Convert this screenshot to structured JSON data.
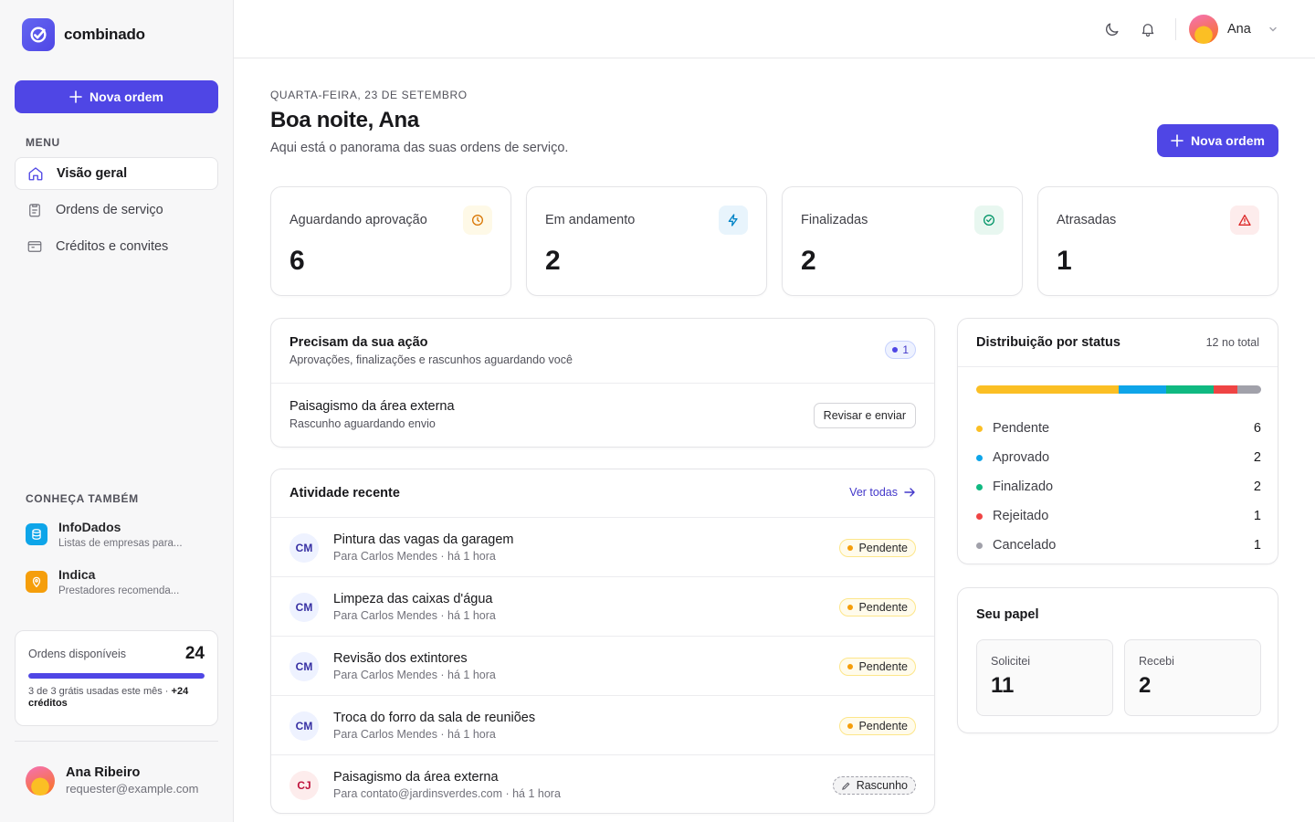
{
  "app": {
    "name": "combinado"
  },
  "sidebar": {
    "new_button": "Nova ordem",
    "menu_label": "MENU",
    "items": [
      {
        "label": "Visão geral",
        "icon": "home-icon",
        "active": true
      },
      {
        "label": "Ordens de serviço",
        "icon": "clipboard-icon",
        "active": false
      },
      {
        "label": "Créditos e convites",
        "icon": "wallet-icon",
        "active": false
      }
    ],
    "discover_label": "CONHEÇA TAMBÉM",
    "promos": [
      {
        "title": "InfoDados",
        "desc": "Listas de empresas para...",
        "color": "#0ea5e9"
      },
      {
        "title": "Indica",
        "desc": "Prestadores recomenda...",
        "color": "#f59e0b"
      }
    ],
    "credits": {
      "label": "Ordens disponíveis",
      "count": "24",
      "progress": 1.0,
      "note": "3 de 3 grátis usadas este mês · ",
      "note_bold": "+24 créditos"
    },
    "user": {
      "name": "Ana Ribeiro",
      "email": "requester@example.com"
    }
  },
  "topbar": {
    "user_name": "Ana",
    "icons": [
      "moon-icon",
      "bell-icon",
      "chevron-down-icon"
    ]
  },
  "header": {
    "date": "QUARTA-FEIRA, 23 DE SETEMBRO",
    "greeting": "Boa noite, Ana",
    "subtitle": "Aqui está o panorama das suas ordens de serviço.",
    "new_button": "Nova ordem"
  },
  "stats": [
    {
      "title": "Aguardando aprovação",
      "value": "6",
      "icon": "clock-icon",
      "color": "#d97706",
      "bg": "#fef9e7"
    },
    {
      "title": "Em andamento",
      "value": "2",
      "icon": "bolt-icon",
      "color": "#0284c7",
      "bg": "#e8f4fc"
    },
    {
      "title": "Finalizadas",
      "value": "2",
      "icon": "check-circle-icon",
      "color": "#059669",
      "bg": "#e8f7f0"
    },
    {
      "title": "Atrasadas",
      "value": "1",
      "icon": "alert-triangle-icon",
      "color": "#dc2626",
      "bg": "#fdecec"
    }
  ],
  "action": {
    "title": "Precisam da sua ação",
    "subtitle": "Aprovações, finalizações e rascunhos aguardando você",
    "count": "1",
    "item": {
      "title": "Paisagismo da área externa",
      "subtitle": "Rascunho aguardando envio",
      "button": "Revisar e enviar"
    }
  },
  "activity": {
    "title": "Atividade recente",
    "view_all": "Ver todas",
    "rows": [
      {
        "initials": "CM",
        "title": "Pintura das vagas da garagem",
        "meta": "Para Carlos Mendes · há 1 hora",
        "status": "Pendente",
        "kind": "pending"
      },
      {
        "initials": "CM",
        "title": "Limpeza das caixas d'água",
        "meta": "Para Carlos Mendes · há 1 hora",
        "status": "Pendente",
        "kind": "pending"
      },
      {
        "initials": "CM",
        "title": "Revisão dos extintores",
        "meta": "Para Carlos Mendes · há 1 hora",
        "status": "Pendente",
        "kind": "pending"
      },
      {
        "initials": "CM",
        "title": "Troca do forro da sala de reuniões",
        "meta": "Para Carlos Mendes · há 1 hora",
        "status": "Pendente",
        "kind": "pending"
      },
      {
        "initials": "CJ",
        "title": "Paisagismo da área externa",
        "meta": "Para contato@jardinsverdes.com · há 1 hora",
        "status": "Rascunho",
        "kind": "draft"
      }
    ]
  },
  "distribution": {
    "title": "Distribuição por status",
    "total": "12 no total",
    "items": [
      {
        "label": "Pendente",
        "value": 6,
        "color": "#fbbf24"
      },
      {
        "label": "Aprovado",
        "value": 2,
        "color": "#0ea5e9"
      },
      {
        "label": "Finalizado",
        "value": 2,
        "color": "#10b981"
      },
      {
        "label": "Rejeitado",
        "value": 1,
        "color": "#ef4444"
      },
      {
        "label": "Cancelado",
        "value": 1,
        "color": "#a1a1aa"
      }
    ]
  },
  "role": {
    "title": "Seu papel",
    "boxes": [
      {
        "label": "Solicitei",
        "value": "11"
      },
      {
        "label": "Recebi",
        "value": "2"
      }
    ]
  }
}
